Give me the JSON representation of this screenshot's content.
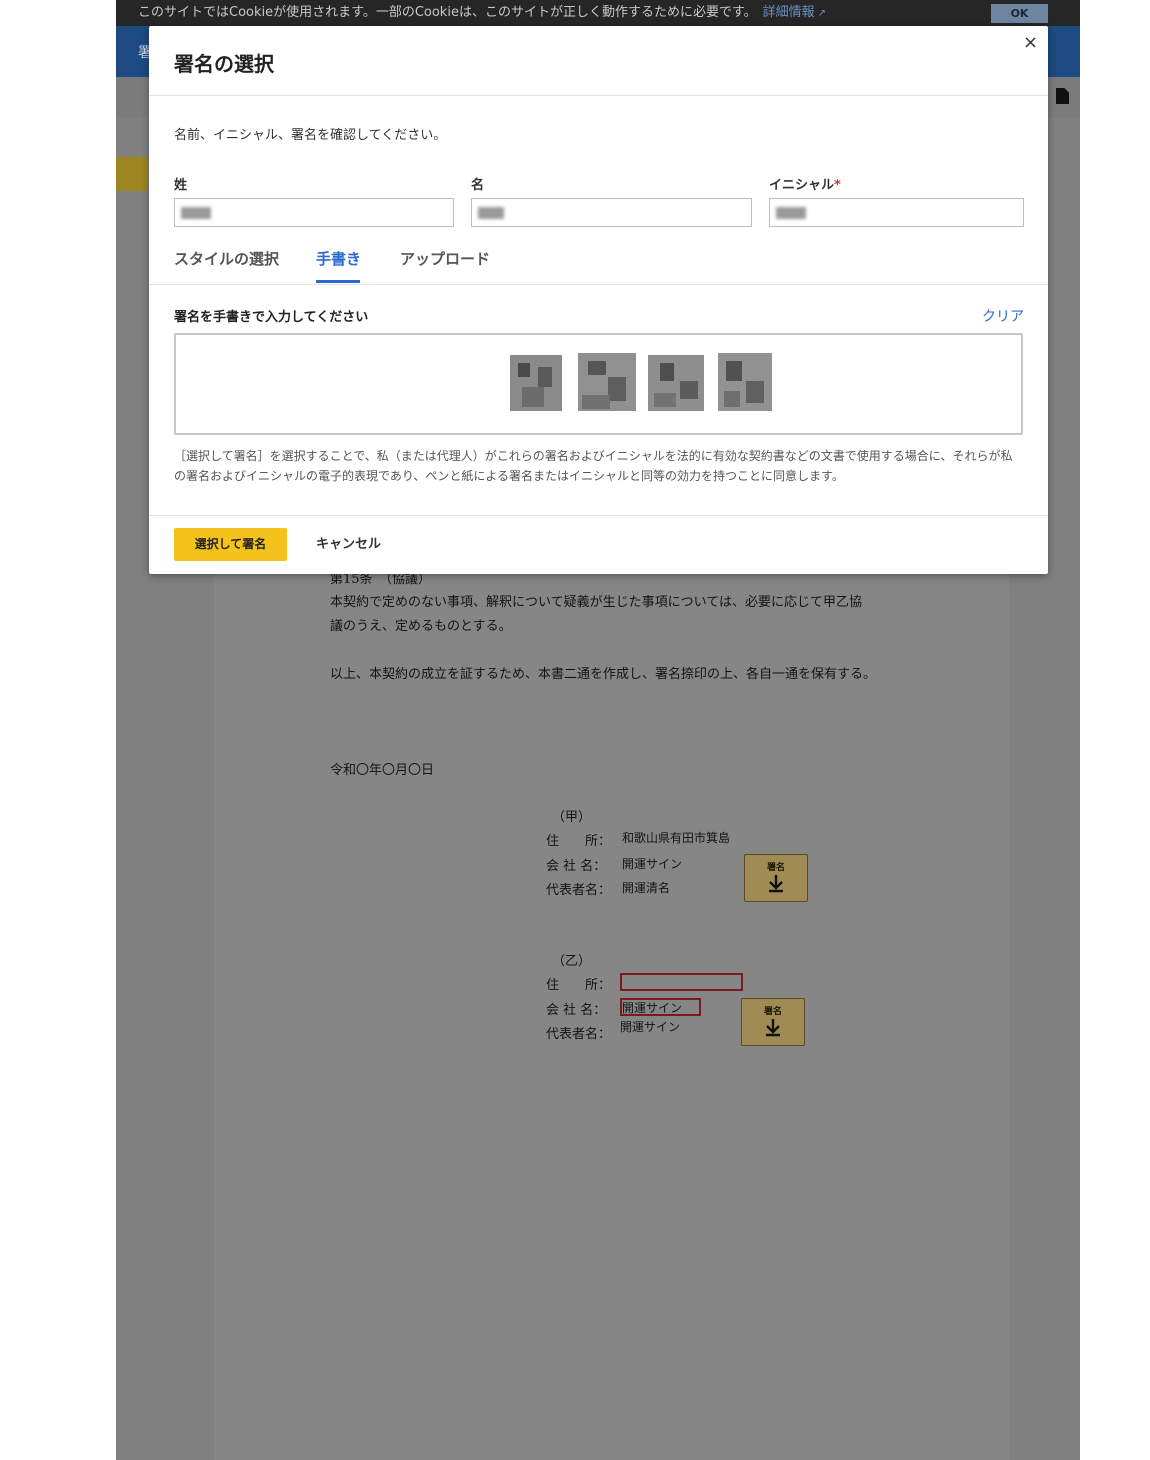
{
  "cookie_bar": {
    "text": "このサイトではCookieが使用されます。一部のCookieは、このサイトが正しく動作するために必要です。",
    "link": "詳細情報",
    "ok": "OK"
  },
  "topbar": {
    "title_fragment": "署"
  },
  "modal": {
    "title": "署名の選択",
    "close": "×",
    "description": "名前、イニシャル、署名を確認してください。",
    "fields": {
      "last_name_label": "姓",
      "first_name_label": "名",
      "initials_label": "イニシャル",
      "required_mark": "*"
    },
    "tabs": [
      "スタイルの選択",
      "手書き",
      "アップロード"
    ],
    "active_tab": 1,
    "handwriting_label": "署名を手書きで入力してください",
    "clear": "クリア",
    "legal": "［選択して署名］を選択することで、私（または代理人）がこれらの署名およびイニシャルを法的に有効な契約書などの文書で使用する場合に、それらが私の署名およびイニシャルの電子的表現であり、ペンと紙による署名またはイニシャルと同等の効力を持つことに同意します。",
    "submit": "選択して署名",
    "cancel": "キャンセル"
  },
  "document": {
    "article_heading": "第15条　（協議）",
    "para1_line1": "本契約で定めのない事項、解釈について疑義が生じた事項については、必要に応じて甲乙協",
    "para1_line2": "議のうえ、定めるものとする。",
    "para2": "以上、本契約の成立を証するため、本書二通を作成し、署名捺印の上、各自一通を保有する。",
    "date": "令和〇年〇月〇日",
    "party_a": {
      "heading": "（甲）",
      "address_label": "住　　所：",
      "address": "和歌山県有田市箕島",
      "company_label": "会 社 名：",
      "company": "開運サイン",
      "rep_label": "代表者名：",
      "rep": "開運清名",
      "sign_label": "署名"
    },
    "party_b": {
      "heading": "（乙）",
      "address_label": "住　　所：",
      "company_label": "会 社 名：",
      "company": "開運サイン",
      "rep_label": "代表者名：",
      "rep": "開運サイン",
      "sign_label": "署名"
    }
  }
}
